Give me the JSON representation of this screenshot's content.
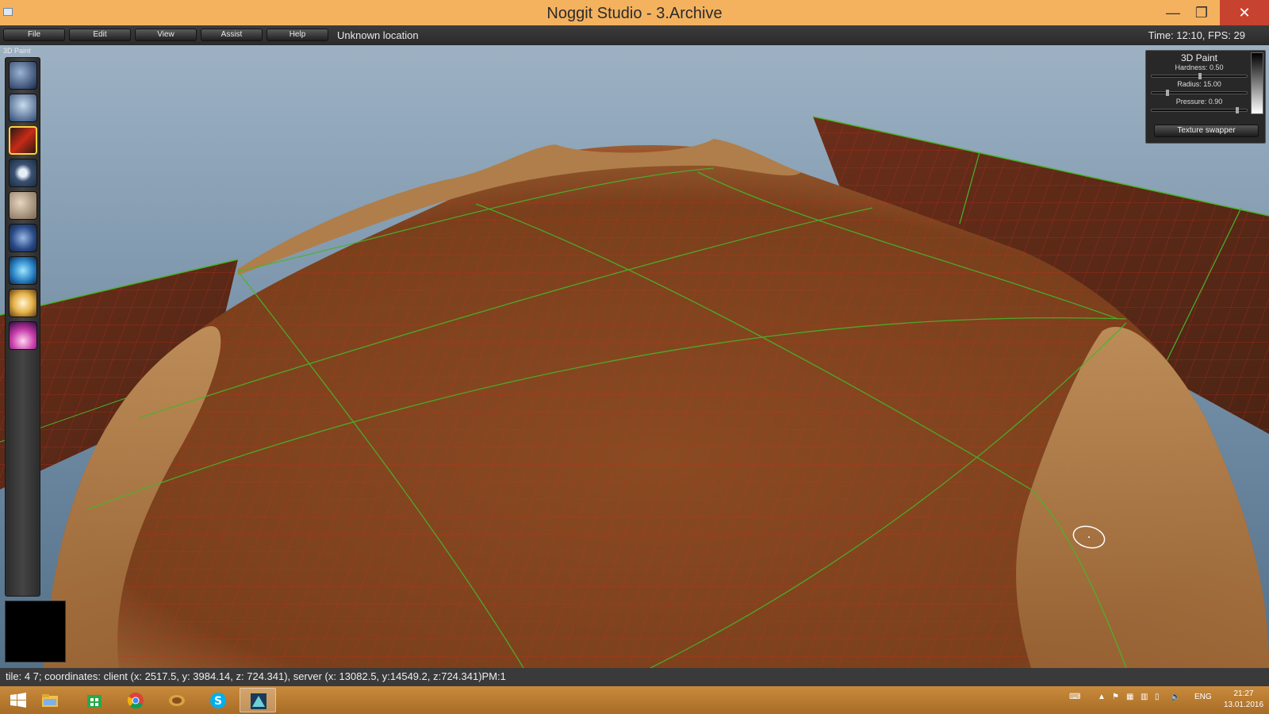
{
  "window": {
    "title": "Noggit Studio - 3.Archive",
    "minimize_glyph": "—",
    "maximize_glyph": "❐",
    "close_glyph": "✕"
  },
  "menu": {
    "items": [
      "File",
      "Edit",
      "View",
      "Assist",
      "Help"
    ],
    "location": "Unknown location",
    "time_fps": "Time: 12:10, FPS: 29"
  },
  "toolbar": {
    "label": "3D Paint",
    "tools": [
      {
        "icon": "raise-lower-icon",
        "selected": false
      },
      {
        "icon": "flatten-blur-icon",
        "selected": false
      },
      {
        "icon": "paint-brush-icon",
        "selected": true
      },
      {
        "icon": "holes-icon",
        "selected": false
      },
      {
        "icon": "area-id-icon",
        "selected": false
      },
      {
        "icon": "impassible-flag-icon",
        "selected": false
      },
      {
        "icon": "water-icon",
        "selected": false
      },
      {
        "icon": "light-icon",
        "selected": false
      },
      {
        "icon": "object-editor-icon",
        "selected": false
      }
    ]
  },
  "paint_panel": {
    "title": "3D Paint",
    "hardness_label": "Hardness: 0.50",
    "hardness": 0.5,
    "radius_label": "Radius: 15.00",
    "radius_fraction": 0.15,
    "pressure_label": "Pressure: 0.90",
    "pressure": 0.9,
    "texture_swapper": "Texture swapper"
  },
  "status": {
    "text": "tile: 4 7; coordinates: client (x: 2517.5, y: 3984.14, z: 724.341), server (x: 13082.5, y:14549.2, z:724.341)PM:1"
  },
  "taskbar": {
    "apps": [
      "windows-start-icon",
      "file-explorer-icon",
      "store-icon",
      "chrome-icon",
      "wow-icon",
      "skype-icon",
      "noggit-icon"
    ],
    "language": "ENG",
    "time": "21:27",
    "date": "13.01.2016"
  },
  "colors": {
    "titlebar": "#f4b25f",
    "taskbar": "#b8792f",
    "terrain": "#8c4a23",
    "grid_red": "#d62a1a",
    "grid_green": "#47b52a"
  }
}
